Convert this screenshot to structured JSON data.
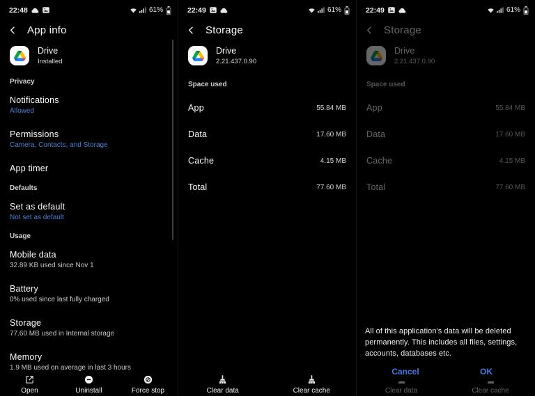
{
  "colors": {
    "link_blue": "#4a80d4",
    "button_blue": "#3f7ce2"
  },
  "status": {
    "left": {
      "time": "22:48",
      "battery": "61%"
    },
    "mid": {
      "time": "22:49",
      "battery": "61%"
    },
    "right": {
      "time": "22:49",
      "battery": "61%"
    }
  },
  "app_info": {
    "title": "App info",
    "app_name": "Drive",
    "app_sub": "Installed",
    "sections": {
      "privacy": "Privacy",
      "defaults": "Defaults",
      "usage": "Usage"
    },
    "items": {
      "notifications": {
        "title": "Notifications",
        "sub": "Allowed"
      },
      "permissions": {
        "title": "Permissions",
        "sub": "Camera, Contacts, and Storage"
      },
      "app_timer": {
        "title": "App timer"
      },
      "set_default": {
        "title": "Set as default",
        "sub": "Not set as default"
      },
      "mobile_data": {
        "title": "Mobile data",
        "sub": "32.89 KB used since Nov 1"
      },
      "battery": {
        "title": "Battery",
        "sub": "0% used since last fully charged"
      },
      "storage": {
        "title": "Storage",
        "sub": "77.60 MB used in Internal storage"
      },
      "memory": {
        "title": "Memory",
        "sub": "1.9 MB used on average in last 3 hours"
      }
    },
    "actions": {
      "open": "Open",
      "uninstall": "Uninstall",
      "force_stop": "Force stop"
    }
  },
  "storage": {
    "title": "Storage",
    "app_name": "Drive",
    "app_sub": "2.21.437.0.90",
    "section": "Space used",
    "rows": [
      {
        "label": "App",
        "value": "55.84 MB"
      },
      {
        "label": "Data",
        "value": "17.60 MB"
      },
      {
        "label": "Cache",
        "value": "4.15 MB"
      },
      {
        "label": "Total",
        "value": "77.60 MB"
      }
    ],
    "actions": {
      "clear_data": "Clear data",
      "clear_cache": "Clear cache"
    }
  },
  "dialog": {
    "message": "All of this application's data will be deleted permanently. This includes all files, settings, accounts, databases etc.",
    "cancel": "Cancel",
    "ok": "OK"
  }
}
